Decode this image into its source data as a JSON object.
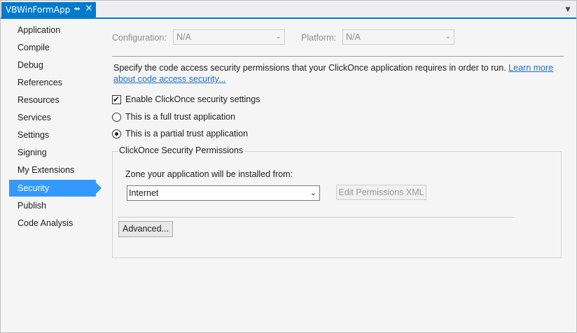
{
  "tab": {
    "title": "VBWinFormApp"
  },
  "nav": {
    "items": [
      {
        "label": "Application"
      },
      {
        "label": "Compile"
      },
      {
        "label": "Debug"
      },
      {
        "label": "References"
      },
      {
        "label": "Resources"
      },
      {
        "label": "Services"
      },
      {
        "label": "Settings"
      },
      {
        "label": "Signing"
      },
      {
        "label": "My Extensions"
      },
      {
        "label": "Security"
      },
      {
        "label": "Publish"
      },
      {
        "label": "Code Analysis"
      }
    ],
    "selected": "Security"
  },
  "config": {
    "configuration_label": "Configuration:",
    "configuration_value": "N/A",
    "platform_label": "Platform:",
    "platform_value": "N/A"
  },
  "security": {
    "description": "Specify the code access security permissions that your ClickOnce application requires in order to run.",
    "learn_more": "Learn more about code access security...",
    "enable_label": "Enable ClickOnce security settings",
    "enable_checked": true,
    "full_trust_label": "This is a full trust application",
    "partial_trust_label": "This is a partial trust application",
    "selected_trust": "partial",
    "group_title": "ClickOnce Security Permissions",
    "zone_label": "Zone your application will be installed from:",
    "zone_value": "Internet",
    "edit_xml_label": "Edit Permissions XML",
    "advanced_label": "Advanced..."
  },
  "colors": {
    "accent": "#007acc",
    "selection": "#3399ff",
    "link": "#1e6fc9"
  }
}
